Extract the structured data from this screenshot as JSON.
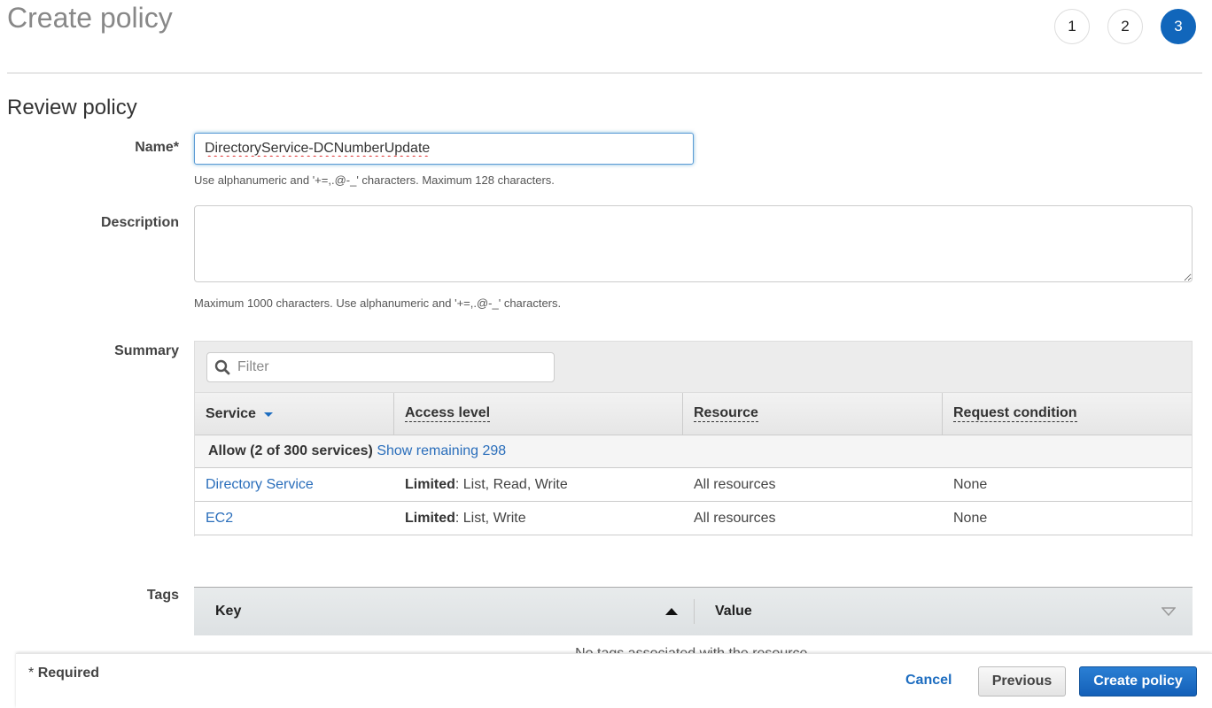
{
  "page": {
    "title": "Create policy",
    "steps": [
      {
        "label": "1",
        "active": false
      },
      {
        "label": "2",
        "active": false
      },
      {
        "label": "3",
        "active": true
      }
    ],
    "section_title": "Review policy"
  },
  "form": {
    "name_label": "Name*",
    "name_value": "DirectoryService-DCNumberUpdate",
    "name_hint": "Use alphanumeric and '+=,.@-_' characters. Maximum 128 characters.",
    "description_label": "Description",
    "description_value": "",
    "description_hint": "Maximum 1000 characters. Use alphanumeric and '+=,.@-_' characters.",
    "summary_label": "Summary",
    "tags_label": "Tags"
  },
  "summary": {
    "filter_placeholder": "Filter",
    "columns": [
      "Service",
      "Access level",
      "Resource",
      "Request condition"
    ],
    "allow_text": "Allow (2 of 300 services)",
    "show_remaining": "Show remaining 298",
    "rows": [
      {
        "service": "Directory Service",
        "access_bold": "Limited",
        "access_rest": ": List, Read, Write",
        "resource": "All resources",
        "condition": "None"
      },
      {
        "service": "EC2",
        "access_bold": "Limited",
        "access_rest": ": List, Write",
        "resource": "All resources",
        "condition": "None"
      }
    ]
  },
  "tags": {
    "key_header": "Key",
    "value_header": "Value",
    "empty_text": "No tags associated with the resource."
  },
  "footer": {
    "required_star": "*",
    "required_label": "Required",
    "cancel": "Cancel",
    "previous": "Previous",
    "create": "Create policy"
  },
  "colors": {
    "accent": "#1166bb",
    "link": "#2a6ebb",
    "primary_button": "#1d6dc0"
  }
}
